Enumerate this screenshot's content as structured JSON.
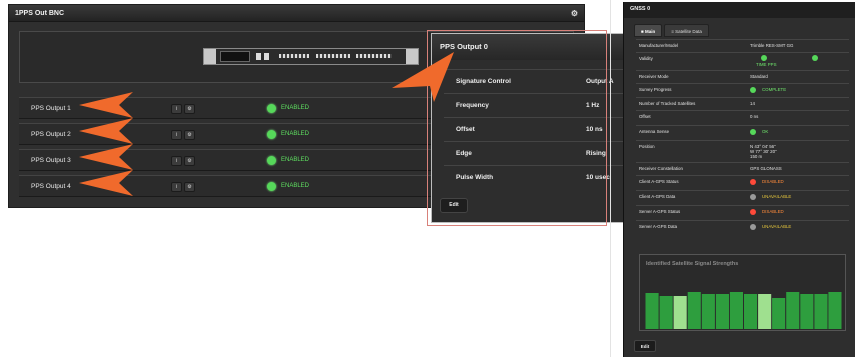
{
  "pps_panel": {
    "title": "1PPS Out BNC",
    "outputs": [
      {
        "label": "PPS Output 1",
        "status": "ENABLED"
      },
      {
        "label": "PPS Output 2",
        "status": "ENABLED"
      },
      {
        "label": "PPS Output 3",
        "status": "ENABLED"
      },
      {
        "label": "PPS Output 4",
        "status": "ENABLED"
      }
    ],
    "info_btn": "i",
    "gear_btn": "⚙",
    "title_gear": "⚙"
  },
  "detail_panel": {
    "title": "PPS Output 0",
    "rows": [
      {
        "key": "Signature Control",
        "value": "Output A"
      },
      {
        "key": "Frequency",
        "value": "1 Hz"
      },
      {
        "key": "Offset",
        "value": "10 ns"
      },
      {
        "key": "Edge",
        "value": "Rising"
      },
      {
        "key": "Pulse Width",
        "value": "10 usec"
      }
    ],
    "edit_label": "Edit"
  },
  "gnss_panel": {
    "title": "GNSS 0",
    "tabs": [
      "Main",
      "Satellite Data"
    ],
    "rows": [
      {
        "key": "Manufacturer/Model",
        "value": "Trimble RES-SMT GG"
      },
      {
        "key": "Validity",
        "value": "TIME          PPS"
      },
      {
        "key": "Receiver Mode",
        "value": "Standard"
      },
      {
        "key": "Survey Progress",
        "value": "COMPLETE"
      },
      {
        "key": "Number of Tracked Satellites",
        "value": "14"
      },
      {
        "key": "Offset",
        "value": "0 ns"
      },
      {
        "key": "Antenna Sense",
        "value": "OK"
      },
      {
        "key": "Position",
        "value": "N 43° 04' 56\"\nW 77° 30' 20\"\n150 m"
      },
      {
        "key": "Receiver Constellation",
        "value": "GPS GLONASS"
      },
      {
        "key": "Client A-GPS Status",
        "value": "DISABLED"
      },
      {
        "key": "Client A-GPS Data",
        "value": "UNAVAILABLE"
      },
      {
        "key": "Server A-GPS Status",
        "value": "DISABLED"
      },
      {
        "key": "Server A-GPS Data",
        "value": "UNAVAILABLE"
      }
    ],
    "signal_title": "Identified Satellite Signal Strengths",
    "signal_levels": [
      0.72,
      0.66,
      0.66,
      0.74,
      0.7,
      0.7,
      0.74,
      0.7,
      0.7,
      0.62,
      0.74,
      0.7,
      0.7,
      0.74
    ],
    "signal_colors": [
      "#2e9e3e",
      "#2e9e3e",
      "#9fe08f",
      "#2e9e3e",
      "#2e9e3e",
      "#2e9e3e",
      "#2e9e3e",
      "#2e9e3e",
      "#9fe08f",
      "#2e9e3e",
      "#2e9e3e",
      "#2e9e3e",
      "#2e9e3e",
      "#2e9e3e"
    ],
    "edit_label": "Edit"
  },
  "colors": {
    "enabled_green": "#5ee060",
    "arrow_orange": "#f06a2c",
    "disabled_orange": "#ff8a3a",
    "unavailable_yellow": "#e4c53c"
  }
}
